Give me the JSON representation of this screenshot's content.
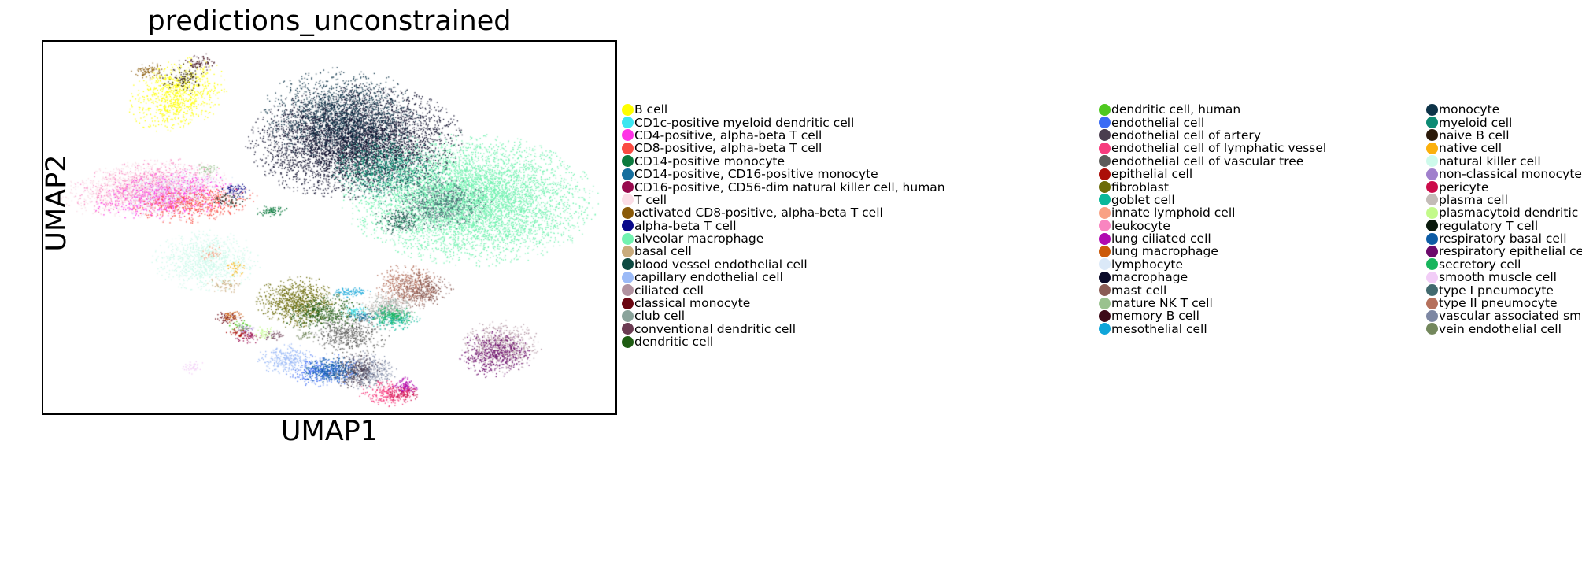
{
  "chart_data": {
    "type": "scatter",
    "title": "predictions_unconstrained",
    "xlabel": "UMAP1",
    "ylabel": "UMAP2",
    "grid": false,
    "axis_ticks": false,
    "legend_position": "right",
    "legend_columns": 3,
    "point_size": 1.3,
    "xlim": [
      0,
      1
    ],
    "ylim": [
      0,
      1
    ],
    "description": "UMAP embedding of single cells colored by predicted cell type (unconstrained predictions).",
    "series": [
      {
        "name": "B cell",
        "color": "#ffff00",
        "cx": 0.235,
        "cy": 0.855,
        "sx": 0.035,
        "sy": 0.045,
        "n": 900,
        "shape": "blob",
        "rot": -0.5
      },
      {
        "name": "CD1c-positive myeloid dendritic cell",
        "color": "#3ce6f0",
        "cx": 0.545,
        "cy": 0.275,
        "sx": 0.012,
        "sy": 0.008,
        "n": 70,
        "shape": "blob",
        "rot": 0.2
      },
      {
        "name": "CD4-positive, alpha-beta T cell",
        "color": "#ff33e6",
        "cx": 0.215,
        "cy": 0.585,
        "sx": 0.055,
        "sy": 0.028,
        "n": 700,
        "shape": "blob",
        "rot": 0.18
      },
      {
        "name": "CD8-positive, alpha-beta T cell",
        "color": "#fa4b42",
        "cx": 0.265,
        "cy": 0.565,
        "sx": 0.048,
        "sy": 0.022,
        "n": 600,
        "shape": "blob",
        "rot": 0.1
      },
      {
        "name": "CD14-positive monocyte",
        "color": "#0b7a3d",
        "cx": 0.4,
        "cy": 0.545,
        "sx": 0.013,
        "sy": 0.007,
        "n": 90,
        "shape": "blob",
        "rot": 0.0
      },
      {
        "name": "CD14-positive, CD16-positive monocyte",
        "color": "#166f9e",
        "cx": 0.556,
        "cy": 0.26,
        "sx": 0.01,
        "sy": 0.006,
        "n": 60,
        "shape": "blob",
        "rot": 0.0
      },
      {
        "name": "CD16-positive, CD56-dim natural killer cell, human",
        "color": "#990a4e",
        "cx": 0.36,
        "cy": 0.205,
        "sx": 0.01,
        "sy": 0.008,
        "n": 50,
        "shape": "blob",
        "rot": 0.0
      },
      {
        "name": "T cell",
        "color": "#fbdde6",
        "cx": 0.175,
        "cy": 0.605,
        "sx": 0.062,
        "sy": 0.032,
        "n": 1500,
        "shape": "blob",
        "rot": 0.2
      },
      {
        "name": "activated CD8-positive, alpha-beta T cell",
        "color": "#8a5a08",
        "cx": 0.185,
        "cy": 0.92,
        "sx": 0.014,
        "sy": 0.01,
        "n": 80,
        "shape": "blob",
        "rot": 0.0
      },
      {
        "name": "alpha-beta T cell",
        "color": "#0a0a8a",
        "cx": 0.335,
        "cy": 0.6,
        "sx": 0.012,
        "sy": 0.009,
        "n": 70,
        "shape": "blob",
        "rot": 0.0
      },
      {
        "name": "alveolar macrophage",
        "color": "#71f2b0",
        "cx": 0.745,
        "cy": 0.575,
        "sx": 0.095,
        "sy": 0.075,
        "n": 7000,
        "shape": "blob",
        "rot": -0.12
      },
      {
        "name": "basal cell",
        "color": "#c9ab7c",
        "cx": 0.315,
        "cy": 0.345,
        "sx": 0.013,
        "sy": 0.01,
        "n": 70,
        "shape": "blob",
        "rot": 0.0
      },
      {
        "name": "blood vessel endothelial cell",
        "color": "#0d4a42",
        "cx": 0.625,
        "cy": 0.52,
        "sx": 0.02,
        "sy": 0.018,
        "n": 200,
        "shape": "blob",
        "rot": 0.0
      },
      {
        "name": "capillary endothelial cell",
        "color": "#9bbaf7",
        "cx": 0.425,
        "cy": 0.145,
        "sx": 0.022,
        "sy": 0.018,
        "n": 320,
        "shape": "blob",
        "rot": 0.0
      },
      {
        "name": "ciliated cell",
        "color": "#b192a0",
        "cx": 0.8,
        "cy": 0.18,
        "sx": 0.03,
        "sy": 0.03,
        "n": 650,
        "shape": "blob",
        "rot": 0.0
      },
      {
        "name": "classical monocyte",
        "color": "#6b0611",
        "cx": 0.325,
        "cy": 0.255,
        "sx": 0.012,
        "sy": 0.009,
        "n": 60,
        "shape": "blob",
        "rot": 0.0
      },
      {
        "name": "club cell",
        "color": "#8aa39b",
        "cx": 0.6,
        "cy": 0.275,
        "sx": 0.02,
        "sy": 0.016,
        "n": 180,
        "shape": "blob",
        "rot": 0.0
      },
      {
        "name": "conventional dendritic cell",
        "color": "#6b3b52",
        "cx": 0.405,
        "cy": 0.21,
        "sx": 0.009,
        "sy": 0.007,
        "n": 40,
        "shape": "blob",
        "rot": 0.0
      },
      {
        "name": "dendritic cell",
        "color": "#1e5c12",
        "cx": 0.49,
        "cy": 0.27,
        "sx": 0.032,
        "sy": 0.022,
        "n": 450,
        "shape": "blob",
        "rot": 0.1
      },
      {
        "name": "dendritic cell, human",
        "color": "#4fc920",
        "cx": 0.345,
        "cy": 0.235,
        "sx": 0.01,
        "sy": 0.008,
        "n": 45,
        "shape": "blob",
        "rot": 0.0
      },
      {
        "name": "endothelial cell",
        "color": "#3b6bf5",
        "cx": 0.49,
        "cy": 0.115,
        "sx": 0.028,
        "sy": 0.02,
        "n": 400,
        "shape": "blob",
        "rot": 0.0
      },
      {
        "name": "endothelial cell of artery",
        "color": "#4a3d4f",
        "cx": 0.545,
        "cy": 0.115,
        "sx": 0.02,
        "sy": 0.02,
        "n": 320,
        "shape": "blob",
        "rot": 0.0
      },
      {
        "name": "endothelial cell of lymphatic vessel",
        "color": "#f73c7e",
        "cx": 0.6,
        "cy": 0.055,
        "sx": 0.022,
        "sy": 0.016,
        "n": 260,
        "shape": "blob",
        "rot": 0.0
      },
      {
        "name": "endothelial cell of vascular tree",
        "color": "#5c5c5a",
        "cx": 0.535,
        "cy": 0.215,
        "sx": 0.03,
        "sy": 0.026,
        "n": 500,
        "shape": "blob",
        "rot": 0.0
      },
      {
        "name": "epithelial cell",
        "color": "#ab0e09",
        "cx": 0.345,
        "cy": 0.215,
        "sx": 0.011,
        "sy": 0.009,
        "n": 60,
        "shape": "blob",
        "rot": 0.0
      },
      {
        "name": "fibroblast",
        "color": "#6b6b08",
        "cx": 0.445,
        "cy": 0.3,
        "sx": 0.032,
        "sy": 0.03,
        "n": 900,
        "shape": "blob",
        "rot": 0.0
      },
      {
        "name": "goblet cell",
        "color": "#0ab89a",
        "cx": 0.615,
        "cy": 0.255,
        "sx": 0.02,
        "sy": 0.014,
        "n": 180,
        "shape": "blob",
        "rot": 0.0
      },
      {
        "name": "innate lymphoid cell",
        "color": "#f9a183",
        "cx": 0.295,
        "cy": 0.43,
        "sx": 0.008,
        "sy": 0.01,
        "n": 40,
        "shape": "blob",
        "rot": 0.0
      },
      {
        "name": "leukocyte",
        "color": "#f985c0",
        "cx": 0.185,
        "cy": 0.61,
        "sx": 0.058,
        "sy": 0.03,
        "n": 800,
        "shape": "blob",
        "rot": 0.2
      },
      {
        "name": "lung ciliated cell",
        "color": "#b00ab0",
        "cx": 0.63,
        "cy": 0.075,
        "sx": 0.012,
        "sy": 0.01,
        "n": 100,
        "shape": "blob",
        "rot": 0.0
      },
      {
        "name": "lung macrophage",
        "color": "#cc5a0a",
        "cx": 0.33,
        "cy": 0.26,
        "sx": 0.009,
        "sy": 0.008,
        "n": 45,
        "shape": "blob",
        "rot": 0.0
      },
      {
        "name": "lymphocyte",
        "color": "#dbe9f8",
        "cx": 0.23,
        "cy": 0.6,
        "sx": 0.05,
        "sy": 0.028,
        "n": 500,
        "shape": "blob",
        "rot": 0.2
      },
      {
        "name": "macrophage",
        "color": "#0a0a28",
        "cx": 0.545,
        "cy": 0.73,
        "sx": 0.08,
        "sy": 0.065,
        "n": 5200,
        "shape": "blob",
        "rot": 0.12
      },
      {
        "name": "mast cell",
        "color": "#8a5c55",
        "cx": 0.665,
        "cy": 0.33,
        "sx": 0.022,
        "sy": 0.022,
        "n": 350,
        "shape": "blob",
        "rot": 0.0
      },
      {
        "name": "mature NK T cell",
        "color": "#9ac28f",
        "cx": 0.285,
        "cy": 0.655,
        "sx": 0.009,
        "sy": 0.008,
        "n": 40,
        "shape": "blob",
        "rot": 0.0
      },
      {
        "name": "memory B cell",
        "color": "#3d0a18",
        "cx": 0.275,
        "cy": 0.945,
        "sx": 0.012,
        "sy": 0.01,
        "n": 70,
        "shape": "blob",
        "rot": 0.0
      },
      {
        "name": "mesothelial cell",
        "color": "#0fa5d9",
        "cx": 0.535,
        "cy": 0.325,
        "sx": 0.016,
        "sy": 0.006,
        "n": 90,
        "shape": "blob",
        "rot": 0.15
      },
      {
        "name": "monocyte",
        "color": "#0d3348",
        "cx": 0.52,
        "cy": 0.8,
        "sx": 0.06,
        "sy": 0.055,
        "n": 1800,
        "shape": "blob",
        "rot": 0.0
      },
      {
        "name": "myeloid cell",
        "color": "#0d8a73",
        "cx": 0.6,
        "cy": 0.66,
        "sx": 0.045,
        "sy": 0.04,
        "n": 900,
        "shape": "blob",
        "rot": 0.0
      },
      {
        "name": "naive B cell",
        "color": "#2b1a0a",
        "cx": 0.245,
        "cy": 0.905,
        "sx": 0.018,
        "sy": 0.02,
        "n": 120,
        "shape": "blob",
        "rot": 0.0
      },
      {
        "name": "native cell",
        "color": "#fbb00d",
        "cx": 0.335,
        "cy": 0.39,
        "sx": 0.008,
        "sy": 0.012,
        "n": 45,
        "shape": "blob",
        "rot": 0.0
      },
      {
        "name": "natural killer cell",
        "color": "#cdfaeb",
        "cx": 0.285,
        "cy": 0.41,
        "sx": 0.04,
        "sy": 0.035,
        "n": 1100,
        "shape": "blob",
        "rot": 0.0
      },
      {
        "name": "non-classical monocyte",
        "color": "#a080cc",
        "cx": 0.355,
        "cy": 0.225,
        "sx": 0.009,
        "sy": 0.008,
        "n": 40,
        "shape": "blob",
        "rot": 0.0
      },
      {
        "name": "pericyte",
        "color": "#cc0c4a",
        "cx": 0.63,
        "cy": 0.055,
        "sx": 0.013,
        "sy": 0.01,
        "n": 120,
        "shape": "blob",
        "rot": 0.0
      },
      {
        "name": "plasma cell",
        "color": "#c3bcb7",
        "cx": 0.605,
        "cy": 0.29,
        "sx": 0.022,
        "sy": 0.02,
        "n": 300,
        "shape": "blob",
        "rot": 0.0
      },
      {
        "name": "plasmacytoid dendritic cell",
        "color": "#c3fa8a",
        "cx": 0.385,
        "cy": 0.215,
        "sx": 0.01,
        "sy": 0.008,
        "n": 45,
        "shape": "blob",
        "rot": 0.0
      },
      {
        "name": "regulatory T cell",
        "color": "#0a1a0d",
        "cx": 0.325,
        "cy": 0.575,
        "sx": 0.014,
        "sy": 0.01,
        "n": 60,
        "shape": "blob",
        "rot": 0.0
      },
      {
        "name": "respiratory basal cell",
        "color": "#0d5ca5",
        "cx": 0.5,
        "cy": 0.115,
        "sx": 0.022,
        "sy": 0.016,
        "n": 300,
        "shape": "blob",
        "rot": 0.0
      },
      {
        "name": "respiratory epithelial cell",
        "color": "#6b0a6b",
        "cx": 0.79,
        "cy": 0.16,
        "sx": 0.028,
        "sy": 0.028,
        "n": 500,
        "shape": "blob",
        "rot": 0.0
      },
      {
        "name": "secretory cell",
        "color": "#18b55c",
        "cx": 0.61,
        "cy": 0.265,
        "sx": 0.018,
        "sy": 0.012,
        "n": 150,
        "shape": "blob",
        "rot": 0.0
      },
      {
        "name": "smooth muscle cell",
        "color": "#f2cdf7",
        "cx": 0.26,
        "cy": 0.125,
        "sx": 0.01,
        "sy": 0.008,
        "n": 50,
        "shape": "blob",
        "rot": 0.0
      },
      {
        "name": "type I pneumocyte",
        "color": "#41696e",
        "cx": 0.7,
        "cy": 0.565,
        "sx": 0.035,
        "sy": 0.03,
        "n": 700,
        "shape": "blob",
        "rot": 0.0
      },
      {
        "name": "type II pneumocyte",
        "color": "#b5705c",
        "cx": 0.635,
        "cy": 0.345,
        "sx": 0.026,
        "sy": 0.024,
        "n": 450,
        "shape": "blob",
        "rot": 0.0
      },
      {
        "name": "vascular associated smooth muscle cell",
        "color": "#7d87a3",
        "cx": 0.565,
        "cy": 0.115,
        "sx": 0.024,
        "sy": 0.022,
        "n": 450,
        "shape": "blob",
        "rot": 0.0
      },
      {
        "name": "vein endothelial cell",
        "color": "#73875c",
        "cx": 0.455,
        "cy": 0.21,
        "sx": 0.009,
        "sy": 0.007,
        "n": 40,
        "shape": "blob",
        "rot": 0.0
      }
    ]
  },
  "title": "predictions_unconstrained",
  "axes": {
    "xlabel": "UMAP1",
    "ylabel": "UMAP2"
  },
  "legend": {
    "columns": [
      {
        "items": [
          {
            "label": "B cell",
            "color": "#ffff00"
          },
          {
            "label": "CD1c-positive myeloid dendritic cell",
            "color": "#3ce6f0"
          },
          {
            "label": "CD4-positive, alpha-beta T cell",
            "color": "#ff33e6"
          },
          {
            "label": "CD8-positive, alpha-beta T cell",
            "color": "#fa4b42"
          },
          {
            "label": "CD14-positive monocyte",
            "color": "#0b7a3d"
          },
          {
            "label": "CD14-positive, CD16-positive monocyte",
            "color": "#166f9e"
          },
          {
            "label": "CD16-positive, CD56-dim natural killer cell, human",
            "color": "#990a4e"
          },
          {
            "label": "T cell",
            "color": "#fbdde6"
          },
          {
            "label": "activated CD8-positive, alpha-beta T cell",
            "color": "#8a5a08"
          },
          {
            "label": "alpha-beta T cell",
            "color": "#0a0a8a"
          },
          {
            "label": "alveolar macrophage",
            "color": "#71f2b0"
          },
          {
            "label": "basal cell",
            "color": "#c9ab7c"
          },
          {
            "label": "blood vessel endothelial cell",
            "color": "#0d4a42"
          },
          {
            "label": "capillary endothelial cell",
            "color": "#9bbaf7"
          },
          {
            "label": "ciliated cell",
            "color": "#b192a0"
          },
          {
            "label": "classical monocyte",
            "color": "#6b0611"
          },
          {
            "label": "club cell",
            "color": "#8aa39b"
          },
          {
            "label": "conventional dendritic cell",
            "color": "#6b3b52"
          },
          {
            "label": "dendritic cell",
            "color": "#1e5c12"
          }
        ]
      },
      {
        "items": [
          {
            "label": "dendritic cell, human",
            "color": "#4fc920"
          },
          {
            "label": "endothelial cell",
            "color": "#3b6bf5"
          },
          {
            "label": "endothelial cell of artery",
            "color": "#4a3d4f"
          },
          {
            "label": "endothelial cell of lymphatic vessel",
            "color": "#f73c7e"
          },
          {
            "label": "endothelial cell of vascular tree",
            "color": "#5c5c5a"
          },
          {
            "label": "epithelial cell",
            "color": "#ab0e09"
          },
          {
            "label": "fibroblast",
            "color": "#6b6b08"
          },
          {
            "label": "goblet cell",
            "color": "#0ab89a"
          },
          {
            "label": "innate lymphoid cell",
            "color": "#f9a183"
          },
          {
            "label": "leukocyte",
            "color": "#f985c0"
          },
          {
            "label": "lung ciliated cell",
            "color": "#b00ab0"
          },
          {
            "label": "lung macrophage",
            "color": "#cc5a0a"
          },
          {
            "label": "lymphocyte",
            "color": "#dbe9f8"
          },
          {
            "label": "macrophage",
            "color": "#0a0a28"
          },
          {
            "label": "mast cell",
            "color": "#8a5c55"
          },
          {
            "label": "mature NK T cell",
            "color": "#9ac28f"
          },
          {
            "label": "memory B cell",
            "color": "#3d0a18"
          },
          {
            "label": "mesothelial cell",
            "color": "#0fa5d9"
          }
        ]
      },
      {
        "items": [
          {
            "label": "monocyte",
            "color": "#0d3348"
          },
          {
            "label": "myeloid cell",
            "color": "#0d8a73"
          },
          {
            "label": "naive B cell",
            "color": "#2b1a0a"
          },
          {
            "label": "native cell",
            "color": "#fbb00d"
          },
          {
            "label": "natural killer cell",
            "color": "#cdfaeb"
          },
          {
            "label": "non-classical monocyte",
            "color": "#a080cc"
          },
          {
            "label": "pericyte",
            "color": "#cc0c4a"
          },
          {
            "label": "plasma cell",
            "color": "#c3bcb7"
          },
          {
            "label": "plasmacytoid dendritic cell",
            "color": "#c3fa8a"
          },
          {
            "label": "regulatory T cell",
            "color": "#0a1a0d"
          },
          {
            "label": "respiratory basal cell",
            "color": "#0d5ca5"
          },
          {
            "label": "respiratory epithelial cell",
            "color": "#6b0a6b"
          },
          {
            "label": "secretory cell",
            "color": "#18b55c"
          },
          {
            "label": "smooth muscle cell",
            "color": "#f2cdf7"
          },
          {
            "label": "type I pneumocyte",
            "color": "#41696e"
          },
          {
            "label": "type II pneumocyte",
            "color": "#b5705c"
          },
          {
            "label": "vascular associated smooth muscle cell",
            "color": "#7d87a3"
          },
          {
            "label": "vein endothelial cell",
            "color": "#73875c"
          }
        ]
      }
    ]
  }
}
